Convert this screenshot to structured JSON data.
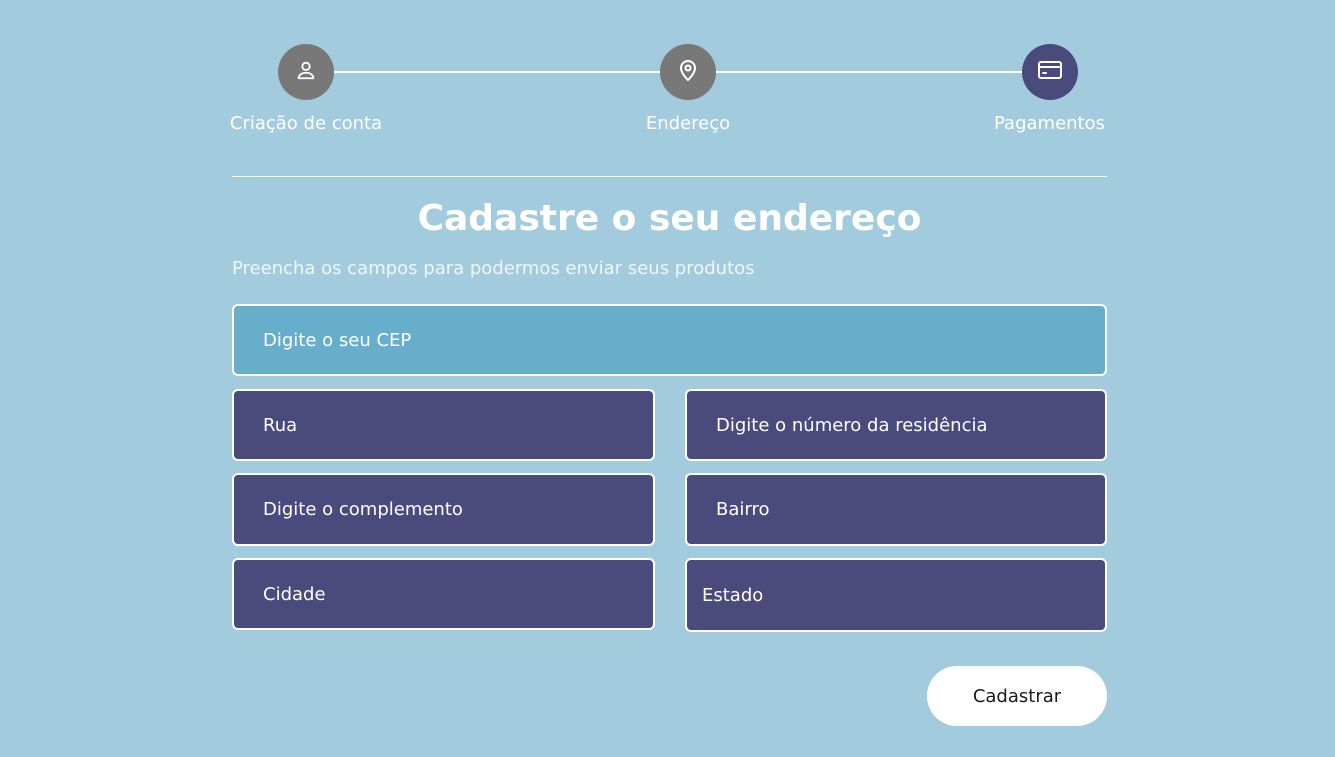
{
  "steps": [
    {
      "label": "Criação de conta",
      "icon": "user-icon",
      "active": false
    },
    {
      "label": "Endereço",
      "icon": "map-pin-icon",
      "active": false
    },
    {
      "label": "Pagamentos",
      "icon": "credit-card-icon",
      "active": true
    }
  ],
  "form": {
    "title": "Cadastre o seu endereço",
    "subtitle": "Preencha os campos para podermos enviar seus produtos",
    "cep_placeholder": "Digite o seu CEP",
    "rua_placeholder": "Rua",
    "numero_placeholder": "Digite o número da residência",
    "complemento_placeholder": "Digite o complemento",
    "bairro_placeholder": "Bairro",
    "cidade_placeholder": "Cidade",
    "estado_label": "Estado",
    "submit_label": "Cadastrar"
  },
  "colors": {
    "background": "#a2cbdd",
    "field": "#4a4a7c",
    "field_focused": "#67aecb",
    "step_inactive": "#787878",
    "step_active": "#4a4a7c"
  }
}
